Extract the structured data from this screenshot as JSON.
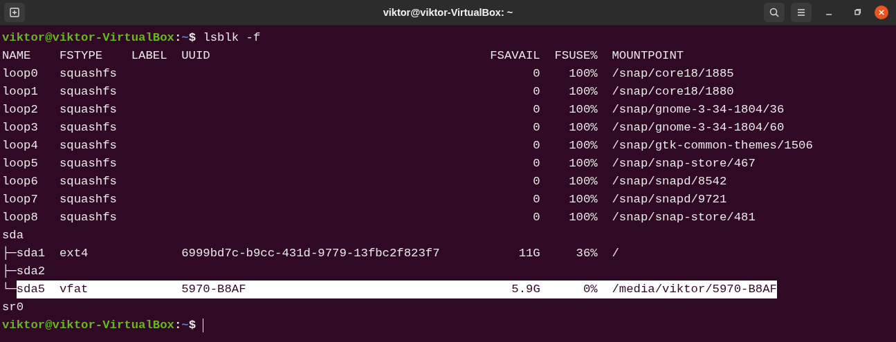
{
  "window": {
    "title": "viktor@viktor-VirtualBox: ~"
  },
  "terminal": {
    "lines": [
      {
        "kind": "prompt",
        "user": "viktor@viktor-VirtualBox",
        "separator": ":",
        "path": "~",
        "symbol": "$",
        "command": "lsblk -f"
      },
      {
        "kind": "header",
        "name": "NAME",
        "fstype": "FSTYPE",
        "label": "LABEL",
        "uuid": "UUID",
        "fsavail": "FSAVAIL",
        "fsuse": "FSUSE%",
        "mountpoint": "MOUNTPOINT"
      },
      {
        "kind": "device",
        "name": "loop0",
        "fstype": "squashfs",
        "fsavail": "0",
        "fsuse": "100%",
        "mountpoint": "/snap/core18/1885",
        "selected": false
      },
      {
        "kind": "device",
        "name": "loop1",
        "fstype": "squashfs",
        "fsavail": "0",
        "fsuse": "100%",
        "mountpoint": "/snap/core18/1880",
        "selected": false
      },
      {
        "kind": "device",
        "name": "loop2",
        "fstype": "squashfs",
        "fsavail": "0",
        "fsuse": "100%",
        "mountpoint": "/snap/gnome-3-34-1804/36",
        "selected": false
      },
      {
        "kind": "device",
        "name": "loop3",
        "fstype": "squashfs",
        "fsavail": "0",
        "fsuse": "100%",
        "mountpoint": "/snap/gnome-3-34-1804/60",
        "selected": false
      },
      {
        "kind": "device",
        "name": "loop4",
        "fstype": "squashfs",
        "fsavail": "0",
        "fsuse": "100%",
        "mountpoint": "/snap/gtk-common-themes/1506",
        "selected": false
      },
      {
        "kind": "device",
        "name": "loop5",
        "fstype": "squashfs",
        "fsavail": "0",
        "fsuse": "100%",
        "mountpoint": "/snap/snap-store/467",
        "selected": false
      },
      {
        "kind": "device",
        "name": "loop6",
        "fstype": "squashfs",
        "fsavail": "0",
        "fsuse": "100%",
        "mountpoint": "/snap/snapd/8542",
        "selected": false
      },
      {
        "kind": "device",
        "name": "loop7",
        "fstype": "squashfs",
        "fsavail": "0",
        "fsuse": "100%",
        "mountpoint": "/snap/snapd/9721",
        "selected": false
      },
      {
        "kind": "device",
        "name": "loop8",
        "fstype": "squashfs",
        "fsavail": "0",
        "fsuse": "100%",
        "mountpoint": "/snap/snap-store/481",
        "selected": false
      },
      {
        "kind": "device",
        "name": "sda",
        "selected": false
      },
      {
        "kind": "device",
        "tree": "├─",
        "name": "sda1",
        "fstype": "ext4",
        "uuid": "6999bd7c-b9cc-431d-9779-13fbc2f823f7",
        "fsavail": "11G",
        "fsuse": "36%",
        "mountpoint": "/",
        "selected": false
      },
      {
        "kind": "device",
        "tree": "├─",
        "name": "sda2",
        "selected": false
      },
      {
        "kind": "device",
        "tree": "└─",
        "name": "sda5",
        "fstype": "vfat",
        "uuid": "5970-B8AF",
        "fsavail": "5.9G",
        "fsuse": "0%",
        "mountpoint": "/media/viktor/5970-B8AF",
        "selected": true
      },
      {
        "kind": "device",
        "name": "sr0",
        "selected": false
      },
      {
        "kind": "prompt",
        "user": "viktor@viktor-VirtualBox",
        "separator": ":",
        "path": "~",
        "symbol": "$",
        "cursor": true
      }
    ]
  }
}
